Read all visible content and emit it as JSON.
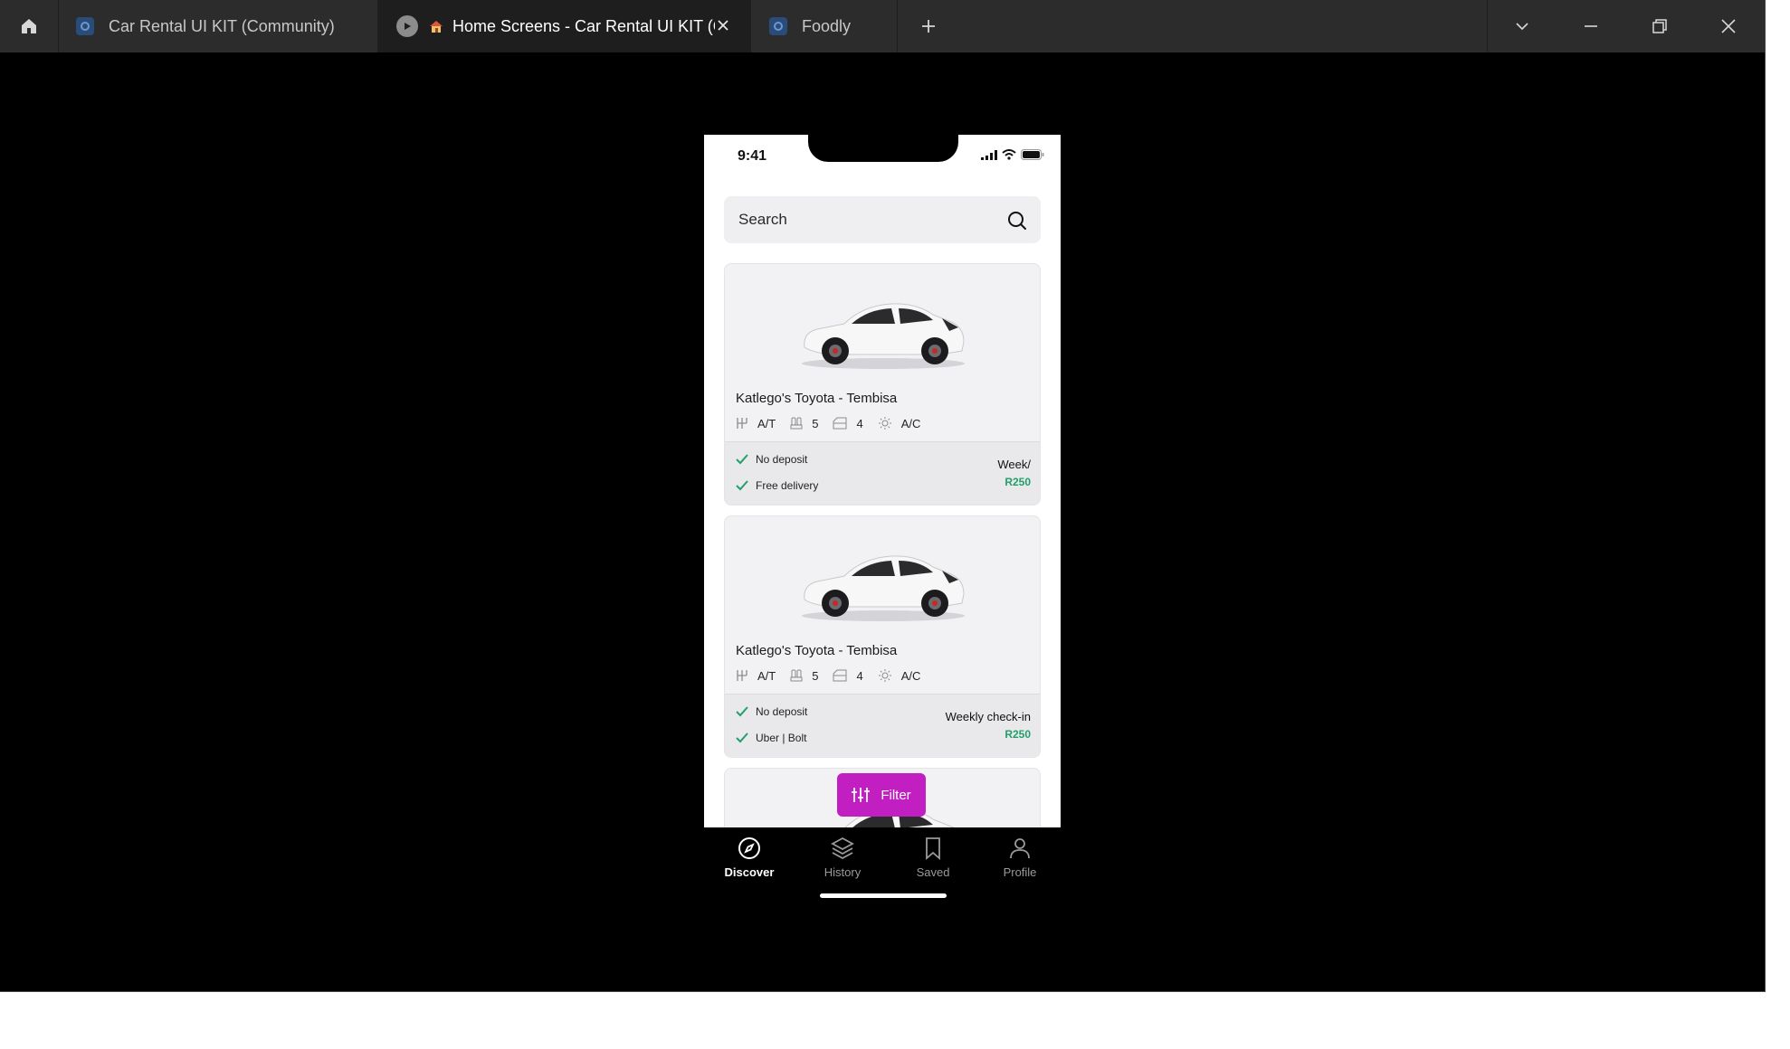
{
  "browser": {
    "tabs": [
      {
        "label": "Car Rental UI KIT (Community)",
        "icon": "figma-file-icon",
        "active": false
      },
      {
        "label": "Home Screens - Car Rental UI KIT (C",
        "icon": "play-icon",
        "active": true
      },
      {
        "label": "Foodly",
        "icon": "figma-file-icon",
        "active": false
      }
    ],
    "colors": {
      "tabbar": "#2c2c2c",
      "active_tab": "#1e1e1e",
      "canvas": "#000000"
    }
  },
  "phone": {
    "status_time": "9:41",
    "search": {
      "placeholder": "Search"
    },
    "cards": [
      {
        "title": "Katlego's Toyota - Tembisa",
        "specs": {
          "transmission": "A/T",
          "seats": "5",
          "doors": "4",
          "climate": "A/C"
        },
        "features": [
          "No deposit",
          "Free delivery"
        ],
        "price_label": "Week/",
        "price": "R250"
      },
      {
        "title": "Katlego's Toyota - Tembisa",
        "specs": {
          "transmission": "A/T",
          "seats": "5",
          "doors": "4",
          "climate": "A/C"
        },
        "features": [
          "No deposit",
          "Uber | Bolt"
        ],
        "price_label": "Weekly check-in",
        "price": "R250"
      }
    ],
    "filter_button": "Filter",
    "nav": [
      {
        "label": "Discover",
        "icon": "compass-icon",
        "active": true
      },
      {
        "label": "History",
        "icon": "layers-icon",
        "active": false
      },
      {
        "label": "Saved",
        "icon": "bookmark-icon",
        "active": false
      },
      {
        "label": "Profile",
        "icon": "user-icon",
        "active": false
      }
    ],
    "colors": {
      "accent": "#c21fc2",
      "price": "#22a06b",
      "check": "#22a06b"
    }
  }
}
